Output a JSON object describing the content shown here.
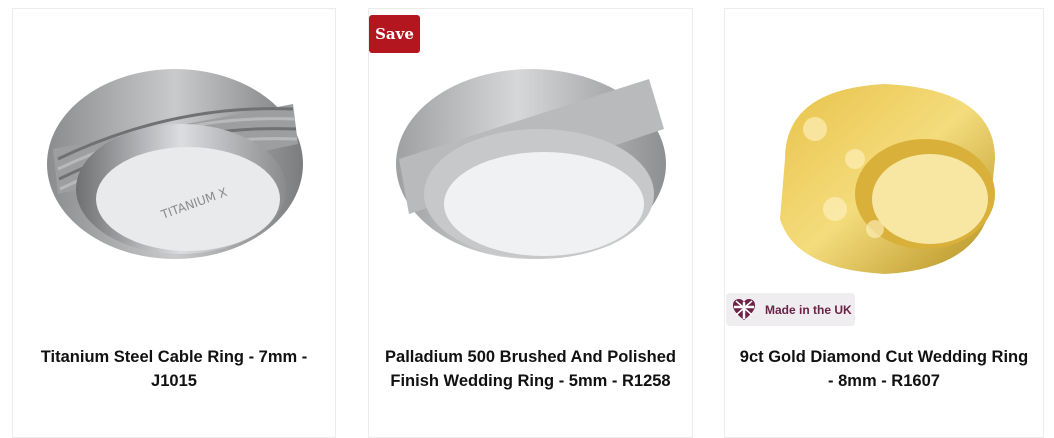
{
  "products": [
    {
      "title": "Titanium Steel Cable Ring - 7mm - J1015",
      "image_alt": "titanium-ring-icon",
      "engraving": "TITANIUM X"
    },
    {
      "title": "Palladium 500 Brushed And Polished Finish Wedding Ring - 5mm - R1258",
      "image_alt": "palladium-ring-icon",
      "badge": "Save"
    },
    {
      "title": "9ct Gold Diamond Cut Wedding Ring - 8mm - R1607",
      "image_alt": "gold-ring-icon",
      "origin_badge": "Made in the UK"
    }
  ],
  "colors": {
    "save_badge": "#b3161f",
    "uk_badge_bg": "#efedef",
    "uk_badge_text": "#6b2246"
  }
}
